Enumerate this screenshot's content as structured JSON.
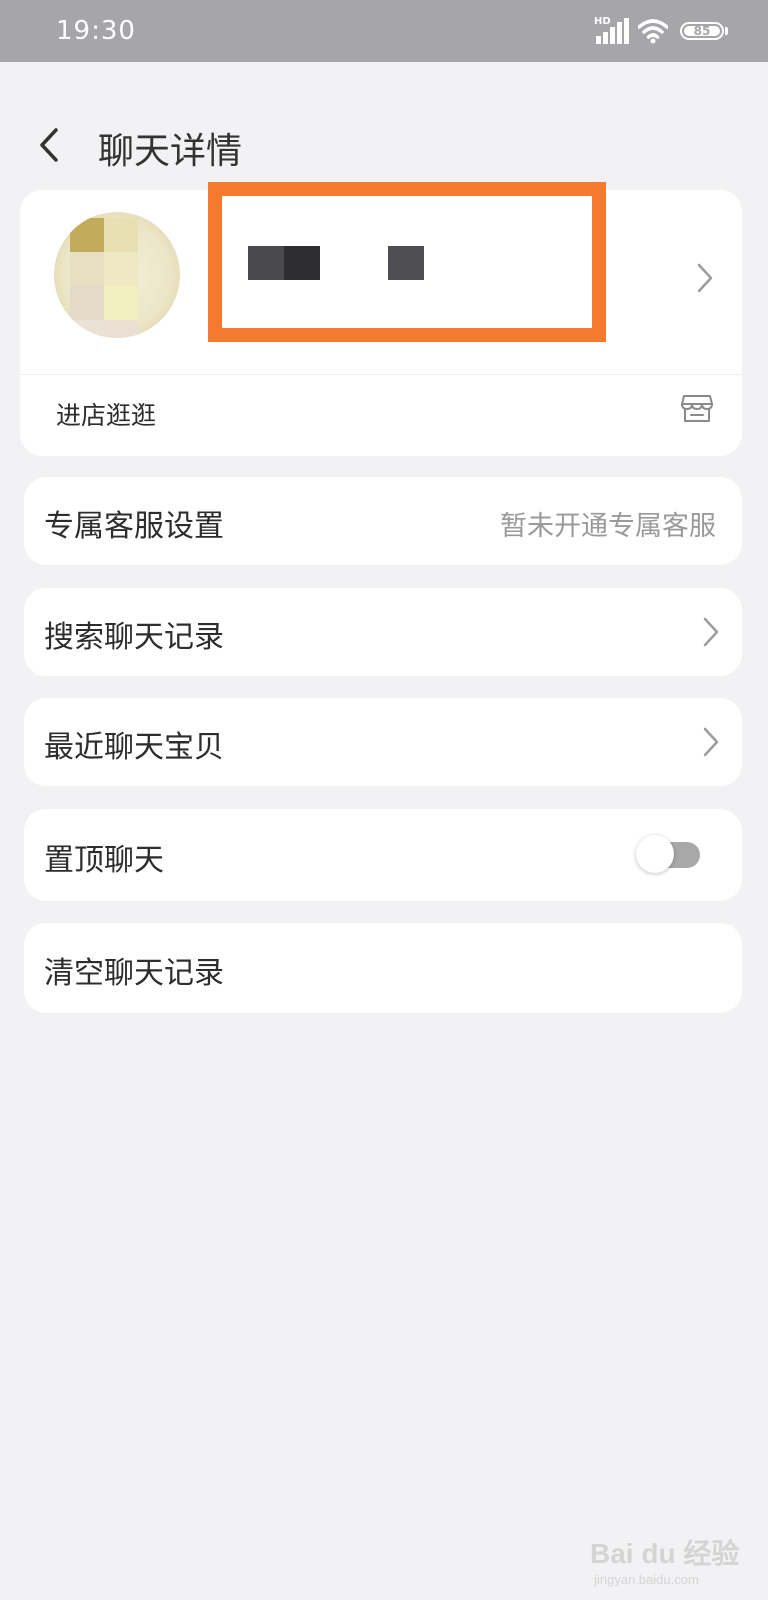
{
  "status_bar": {
    "time": "19:30",
    "network": "HD",
    "battery": "85"
  },
  "header": {
    "title": "聊天详情",
    "back_icon": "chevron-left-icon"
  },
  "shop": {
    "enter_shop_label": "进店逛逛",
    "store_icon": "store-icon",
    "highlight_color": "#f57a2d"
  },
  "settings": {
    "exclusive_service": {
      "label": "专属客服设置",
      "value": "暂未开通专属客服"
    },
    "search_history": {
      "label": "搜索聊天记录"
    },
    "recent_items": {
      "label": "最近聊天宝贝"
    },
    "pin_chat": {
      "label": "置顶聊天",
      "enabled": false
    },
    "clear_history": {
      "label": "清空聊天记录"
    }
  },
  "watermark": {
    "brand": "Bai du 经验",
    "url": "jingyan.baidu.com"
  }
}
